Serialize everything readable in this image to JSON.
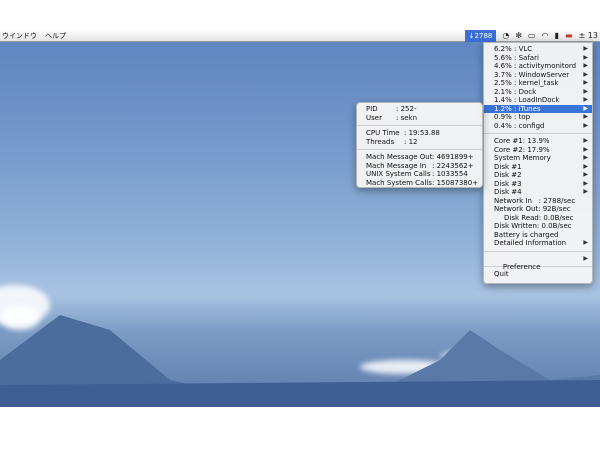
{
  "menubar": {
    "menu_items": [
      "ウインドウ",
      "ヘルプ"
    ],
    "active_item": "↓2788",
    "tray_right_text": "± 13"
  },
  "process_menu": {
    "processes": [
      {
        "label": "6.2% : VLC"
      },
      {
        "label": "5.6% : Safari"
      },
      {
        "label": "4.6% : activitymonitord"
      },
      {
        "label": "3.7% : WindowServer"
      },
      {
        "label": "2.5% : kernel_task"
      },
      {
        "label": "2.1% : Dock"
      },
      {
        "label": "1.4% : LoadInDock"
      },
      {
        "label": "1.2% : iTunes"
      },
      {
        "label": "0.9% : top"
      },
      {
        "label": "0.4% : configd"
      }
    ],
    "selected_index": 7,
    "system_items": [
      {
        "label": "Core #1: 13.9%",
        "arrow": true
      },
      {
        "label": "Core #2: 17.9%",
        "arrow": true
      },
      {
        "label": "System Memory",
        "arrow": true
      },
      {
        "label": "Disk #1",
        "arrow": true
      },
      {
        "label": "Disk #2",
        "arrow": true
      },
      {
        "label": "Disk #3",
        "arrow": true
      },
      {
        "label": "Disk #4",
        "arrow": true
      },
      {
        "label": "Network In   : 2788/sec",
        "arrow": false
      },
      {
        "label": "Network Out: 92B/sec",
        "arrow": false
      },
      {
        "label": "Disk Read: 0.0B/sec",
        "arrow": false,
        "indent": true
      },
      {
        "label": "Disk Written: 0.0B/sec",
        "arrow": false
      },
      {
        "label": "Battery is charged",
        "arrow": false
      },
      {
        "label": "Detailed Information",
        "arrow": true
      }
    ],
    "preference_label": "Preference",
    "quit_label": "Quit"
  },
  "info_popup": {
    "group1": [
      {
        "key": "PID",
        "value": ": 252-"
      },
      {
        "key": "User",
        "value": ": sekn"
      }
    ],
    "group2": [
      {
        "key": "CPU Time",
        "value": ": 19:53.88"
      },
      {
        "key": "Threads",
        "value": ": 12"
      }
    ],
    "group3": [
      {
        "key": "Mach Message Out",
        "value": ": 4691899+"
      },
      {
        "key": "Mach Message In",
        "value": ": 2243562+"
      },
      {
        "key": "UNIX System Calls",
        "value": ": 1033554"
      },
      {
        "key": "Mach System Calls",
        "value": ": 15087380+"
      }
    ]
  }
}
